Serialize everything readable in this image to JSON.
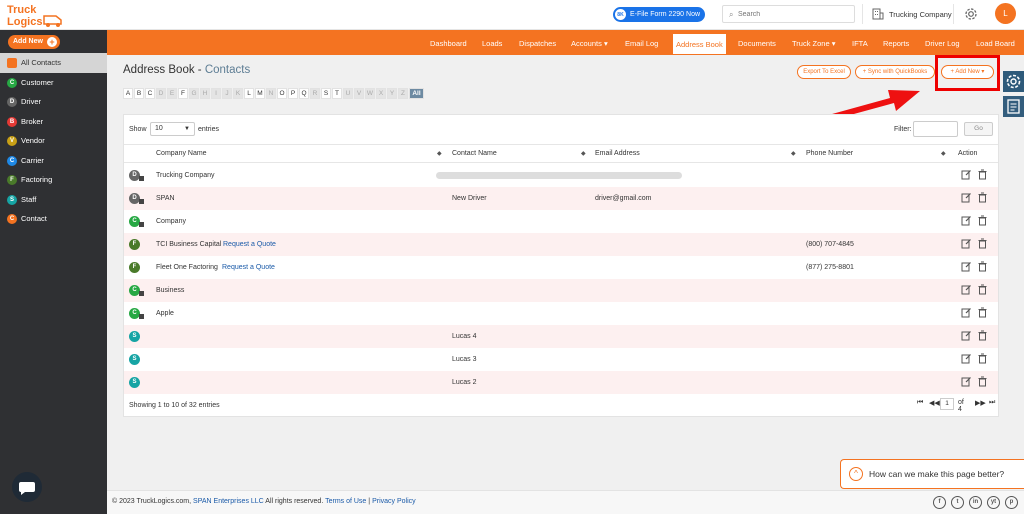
{
  "header": {
    "logo_text": "Truck Logics",
    "efile_badge": "8K",
    "efile_label": "E-File Form 2290 Now",
    "search_placeholder": "Search",
    "company_name": "Trucking Company",
    "avatar_initial": "L"
  },
  "sidebar": {
    "add_new_label": "Add New",
    "items": [
      {
        "label": "All Contacts",
        "letter": "",
        "color": "#f47321"
      },
      {
        "label": "Customer",
        "letter": "C",
        "color": "#27a844"
      },
      {
        "label": "Driver",
        "letter": "D",
        "color": "#666666"
      },
      {
        "label": "Broker",
        "letter": "B",
        "color": "#e53935"
      },
      {
        "label": "Vendor",
        "letter": "V",
        "color": "#c8a016"
      },
      {
        "label": "Carrier",
        "letter": "C",
        "color": "#1e88e5"
      },
      {
        "label": "Factoring",
        "letter": "F",
        "color": "#4a7a2a"
      },
      {
        "label": "Staff",
        "letter": "S",
        "color": "#16a4a4"
      },
      {
        "label": "Contact",
        "letter": "C",
        "color": "#f47321"
      }
    ]
  },
  "nav": {
    "items": [
      "Dashboard",
      "Loads",
      "Dispatches",
      "Accounts",
      "Email Log",
      "Address Book",
      "Documents",
      "Truck Zone",
      "IFTA",
      "Reports",
      "Driver Log",
      "Load Board"
    ],
    "active": "Address Book"
  },
  "page": {
    "title": "Address Book - ",
    "subtitle": "Contacts",
    "export_label": "Export To Excel",
    "sync_label": "Sync with QuickBooks",
    "add_new_label": "Add New"
  },
  "alphabet": {
    "letters": [
      "A",
      "B",
      "C",
      "D",
      "E",
      "F",
      "G",
      "H",
      "I",
      "J",
      "K",
      "L",
      "M",
      "N",
      "O",
      "P",
      "Q",
      "R",
      "S",
      "T",
      "U",
      "V",
      "W",
      "X",
      "Y",
      "Z"
    ],
    "dim": [
      "D",
      "E",
      "G",
      "H",
      "I",
      "J",
      "K",
      "N",
      "R",
      "U",
      "V",
      "W",
      "X",
      "Y",
      "Z"
    ],
    "all_label": "All"
  },
  "table": {
    "show_label": "Show",
    "page_size": "10",
    "entries_label": "entries",
    "filter_label": "Filter:",
    "go_label": "Go",
    "columns": [
      "Company Name",
      "Contact Name",
      "Email Address",
      "Phone Number",
      "Action"
    ],
    "rows": [
      {
        "type": "D",
        "color": "#666666",
        "company": "Trucking Company",
        "quote": "",
        "contact": "",
        "email": "",
        "phone": "",
        "redacted": true
      },
      {
        "type": "D",
        "color": "#666666",
        "company": "SPAN",
        "quote": "",
        "contact": "New Driver",
        "email": "driver@gmail.com",
        "phone": ""
      },
      {
        "type": "C",
        "color": "#27a844",
        "company": "Company",
        "quote": "",
        "contact": "",
        "email": "",
        "phone": ""
      },
      {
        "type": "F",
        "color": "#4a7a2a",
        "company": "TCI Business Capital",
        "quote": "Request a Quote",
        "contact": "",
        "email": "",
        "phone": "(800) 707-4845"
      },
      {
        "type": "F",
        "color": "#4a7a2a",
        "company": "Fleet One Factoring",
        "quote": "Request a Quote",
        "contact": "",
        "email": "",
        "phone": "(877) 275-8801"
      },
      {
        "type": "C",
        "color": "#27a844",
        "company": "Business",
        "quote": "",
        "contact": "",
        "email": "",
        "phone": ""
      },
      {
        "type": "C",
        "color": "#27a844",
        "company": "Apple",
        "quote": "",
        "contact": "",
        "email": "",
        "phone": ""
      },
      {
        "type": "S",
        "color": "#16a4a4",
        "company": "",
        "quote": "",
        "contact": "Lucas 4",
        "email": "",
        "phone": ""
      },
      {
        "type": "S",
        "color": "#16a4a4",
        "company": "",
        "quote": "",
        "contact": "Lucas 3",
        "email": "",
        "phone": ""
      },
      {
        "type": "S",
        "color": "#16a4a4",
        "company": "",
        "quote": "",
        "contact": "Lucas 2",
        "email": "",
        "phone": ""
      }
    ],
    "info": "Showing 1 to 10 of 32 entries",
    "current_page": "1",
    "of_pages": "of 4"
  },
  "feedback": {
    "text": "How can we make this page better?"
  },
  "footer": {
    "copyright": "© 2023 TruckLogics.com,",
    "company_link": "SPAN Enterprises LLC",
    "rights": "All rights reserved.",
    "terms": "Terms of Use",
    "separator": "|",
    "privacy": "Privacy Policy",
    "social": [
      "f",
      "t",
      "in",
      "yt",
      "p"
    ]
  },
  "colors": {
    "brand": "#f47321",
    "highlight": "#ee0000",
    "link": "#1a5aa8"
  }
}
